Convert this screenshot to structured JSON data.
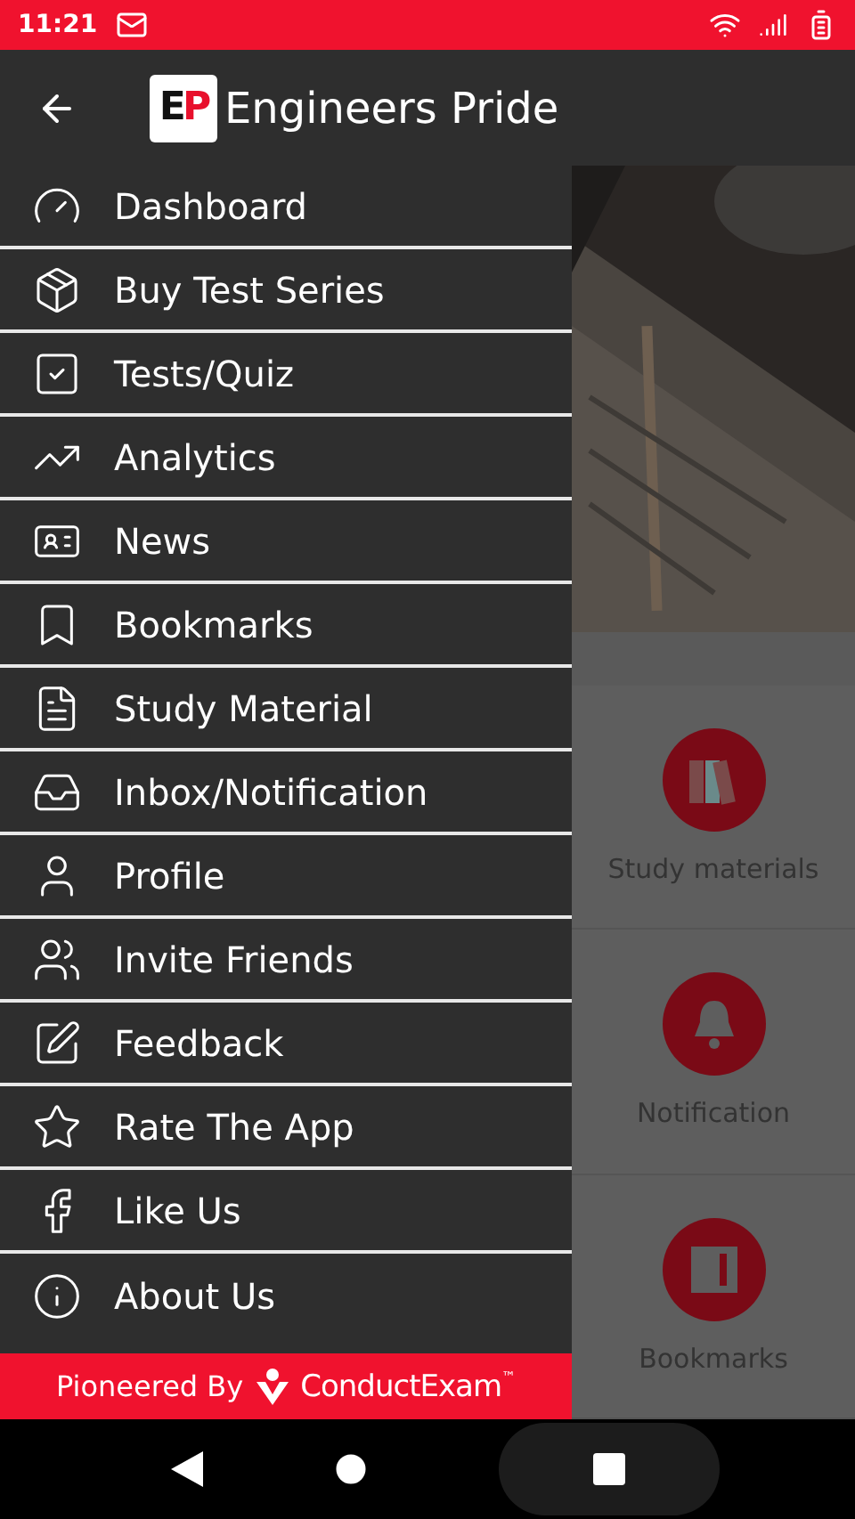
{
  "status_bar": {
    "time": "11:21"
  },
  "app_bar": {
    "logo_letters": [
      {
        "text": "E",
        "color": "#111111"
      },
      {
        "text": "P",
        "color": "#e8102c"
      }
    ],
    "title": "Engineers Pride"
  },
  "drawer": {
    "items": [
      {
        "label": "Dashboard",
        "kind": "dashboard"
      },
      {
        "label": "Buy Test Series",
        "kind": "package"
      },
      {
        "label": "Tests/Quiz",
        "kind": "quiz"
      },
      {
        "label": "Analytics",
        "kind": "analytics"
      },
      {
        "label": "News",
        "kind": "news"
      },
      {
        "label": "Bookmarks",
        "kind": "bookmark"
      },
      {
        "label": "Study Material",
        "kind": "document"
      },
      {
        "label": "Inbox/Notification",
        "kind": "inbox"
      },
      {
        "label": "Profile",
        "kind": "user"
      },
      {
        "label": "Invite Friends",
        "kind": "users"
      },
      {
        "label": "Feedback",
        "kind": "pen"
      },
      {
        "label": "Rate The App",
        "kind": "star"
      },
      {
        "label": "Like Us",
        "kind": "facebook"
      },
      {
        "label": "About Us",
        "kind": "info"
      }
    ],
    "footer": {
      "prefix": "Pioneered By",
      "brand": "ConductExam",
      "trademark": "™"
    }
  },
  "background": {
    "tiles": [
      {
        "label": "Study materials",
        "kind": "books"
      },
      {
        "label": "Notification",
        "kind": "bell"
      },
      {
        "label": "Bookmarks",
        "kind": "book"
      }
    ]
  }
}
